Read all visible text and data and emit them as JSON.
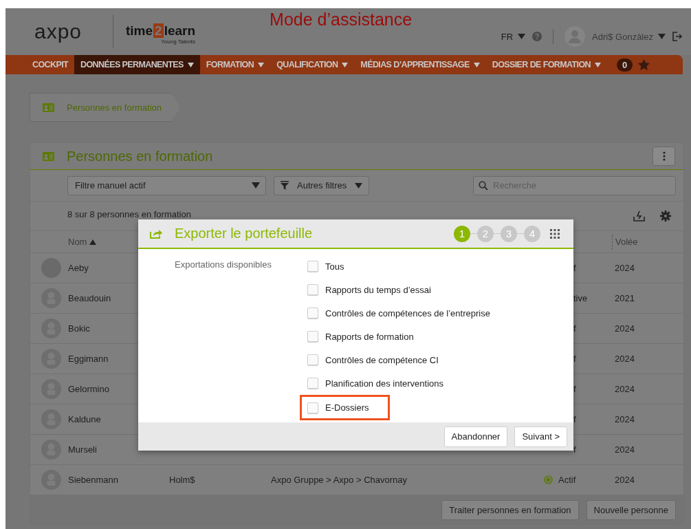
{
  "header": {
    "logo": "axpo",
    "product_logo": {
      "before": "time",
      "digit": "2",
      "after": "learn",
      "tagline": "Young Talents"
    },
    "mode_title": "Mode d’assistance",
    "language": "FR",
    "user_name": "Adri$ Gonzàlez"
  },
  "nav": {
    "items": [
      {
        "label": "COCKPIT",
        "dropdown": false,
        "selected": false
      },
      {
        "label": "DONNÉES PERMANENTES",
        "dropdown": true,
        "selected": true
      },
      {
        "label": "FORMATION",
        "dropdown": true,
        "selected": false
      },
      {
        "label": "QUALIFICATION",
        "dropdown": true,
        "selected": false
      },
      {
        "label": "MÉDIAS D’APPRENTISSAGE",
        "dropdown": true,
        "selected": false
      },
      {
        "label": "DOSSIER DE FORMATION",
        "dropdown": true,
        "selected": false
      }
    ],
    "badge": "0"
  },
  "breadcrumb": "Personnes en formation",
  "panel": {
    "title": "Personnes en formation",
    "filter": "Filtre manuel actif",
    "other_filters": "Autres filtres",
    "search": {
      "placeholder": "Recherche"
    },
    "count": "8 sur 8 personnes en formation",
    "columns": [
      "Nom",
      "Volée"
    ],
    "rows": [
      {
        "kind": "photo",
        "name": "Aeby",
        "column_2": "",
        "column_3": "",
        "status": "f",
        "status_radio": false,
        "year": "2024"
      },
      {
        "kind": "placeholder",
        "name": "Beaudouin",
        "column_2": "",
        "column_3": "",
        "status": "tive",
        "status_radio": false,
        "year": "2021"
      },
      {
        "kind": "placeholder",
        "name": "Bokic",
        "column_2": "",
        "column_3": "",
        "status": "f",
        "status_radio": false,
        "year": "2024"
      },
      {
        "kind": "placeholder",
        "name": "Eggimann",
        "column_2": "",
        "column_3": "",
        "status": "f",
        "status_radio": false,
        "year": "2024"
      },
      {
        "kind": "placeholder",
        "name": "Gelormino",
        "column_2": "",
        "column_3": "",
        "status": "f",
        "status_radio": false,
        "year": "2024"
      },
      {
        "kind": "placeholder",
        "name": "Kaldune",
        "column_2": "",
        "column_3": "",
        "status": "f",
        "status_radio": false,
        "year": "2024"
      },
      {
        "kind": "placeholder",
        "name": "Murseli",
        "column_2": "",
        "column_3": "",
        "status": "f",
        "status_radio": false,
        "year": "2024"
      },
      {
        "kind": "placeholder",
        "name": "Siebenmann",
        "column_2": "Holm$",
        "column_3": "Axpo Gruppe > Axpo > Chavornay",
        "status": "Actif",
        "status_radio": true,
        "year": "2024"
      }
    ],
    "buttons": [
      "Traiter personnes en formation",
      "Nouvelle personne"
    ]
  },
  "dialog": {
    "title": "Exporter le portefeuille",
    "steps": [
      {
        "label": "1",
        "selected": true
      },
      {
        "label": "2",
        "selected": false
      },
      {
        "label": "3",
        "selected": false
      },
      {
        "label": "4",
        "selected": false
      }
    ],
    "field_label": "Exportations disponibles",
    "options": [
      {
        "label": "Tous",
        "checked": false,
        "highlighted": false
      },
      {
        "label": "Rapports du temps d’essai",
        "checked": false,
        "highlighted": false
      },
      {
        "label": "Contrôles de compétences de l’entreprise",
        "checked": false,
        "highlighted": false
      },
      {
        "label": "Rapports de formation",
        "checked": false,
        "highlighted": false
      },
      {
        "label": "Contrôles de compétence CI",
        "checked": false,
        "highlighted": false
      },
      {
        "label": "Planification des interventions",
        "checked": false,
        "highlighted": false
      },
      {
        "label": "E-Dossiers",
        "checked": false,
        "highlighted": true
      }
    ],
    "buttons": [
      "Abandonner",
      "Suivant >"
    ]
  }
}
